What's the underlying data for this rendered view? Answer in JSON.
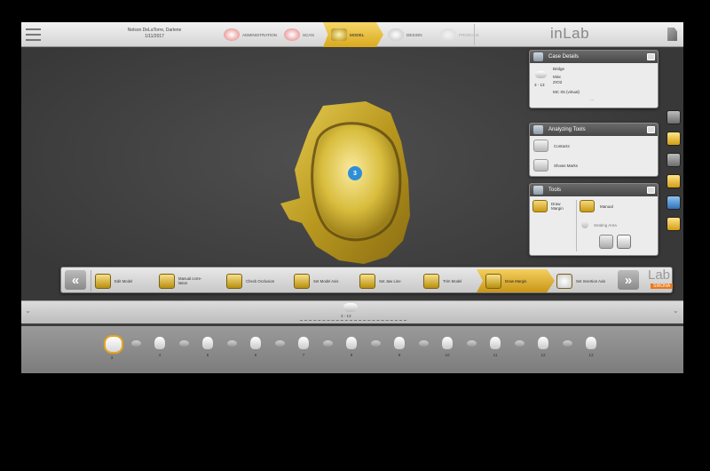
{
  "patient": {
    "name": "Nelson DeLaTorre, Darlene",
    "date": "1/11/2017"
  },
  "phases": [
    {
      "label": "Administration",
      "state": "done"
    },
    {
      "label": "Scan",
      "state": "done"
    },
    {
      "label": "Model",
      "state": "active"
    },
    {
      "label": "Design",
      "state": "done"
    },
    {
      "label": "Produce",
      "state": "disabled"
    }
  ],
  "app_logo": "inLab",
  "case_details": {
    "title": "Case Details",
    "restoration": "Bridge",
    "material1": "Misc",
    "material2": "ZrO2",
    "range": "3 - 13",
    "block": "MC X5 (virtual)",
    "more": "..."
  },
  "analyzing_tools": {
    "title": "Analyzing Tools",
    "items": [
      "Contacts",
      "Shows Marks"
    ]
  },
  "tools": {
    "title": "Tools",
    "draw_margin": "Draw Margin",
    "manual": "Manual",
    "seating_area": "Seating Area"
  },
  "model_badge": "3",
  "workflow": {
    "steps": [
      "Edit Model",
      "Manual corre-lation",
      "Check Occlusion",
      "Set Model Axis",
      "Set Jaw Line",
      "Trim Model",
      "Draw Margin",
      "Set Insertion Axis"
    ],
    "active": "Draw Margin",
    "brand": "Lab",
    "brand_sub": "SIRONA"
  },
  "summary": {
    "label": "3 - 13"
  },
  "teeth": [
    {
      "num": "3",
      "type": "sel"
    },
    {
      "num": "",
      "type": "gap"
    },
    {
      "num": "4",
      "type": "tooth"
    },
    {
      "num": "",
      "type": "gap"
    },
    {
      "num": "5",
      "type": "tooth"
    },
    {
      "num": "",
      "type": "gap"
    },
    {
      "num": "6",
      "type": "tooth"
    },
    {
      "num": "",
      "type": "gap"
    },
    {
      "num": "7",
      "type": "tooth"
    },
    {
      "num": "",
      "type": "gap"
    },
    {
      "num": "8",
      "type": "tooth"
    },
    {
      "num": "",
      "type": "gap"
    },
    {
      "num": "9",
      "type": "tooth"
    },
    {
      "num": "",
      "type": "gap"
    },
    {
      "num": "10",
      "type": "tooth"
    },
    {
      "num": "",
      "type": "gap"
    },
    {
      "num": "11",
      "type": "tooth"
    },
    {
      "num": "",
      "type": "gap"
    },
    {
      "num": "12",
      "type": "tooth"
    },
    {
      "num": "",
      "type": "gap"
    },
    {
      "num": "13",
      "type": "tooth"
    }
  ],
  "colors": {
    "accent": "#e5a51a",
    "model_gold": "#d7bd3a",
    "badge_blue": "#2e8fd6"
  }
}
